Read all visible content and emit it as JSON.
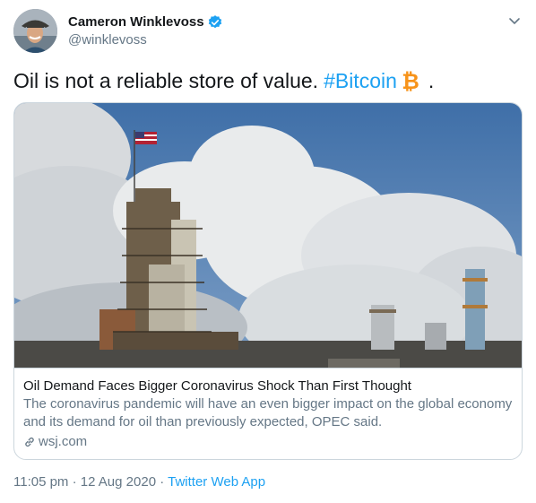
{
  "author": {
    "name": "Cameron Winklevoss",
    "handle": "@winklevoss",
    "verified": true
  },
  "icons": {
    "verified": "verified-badge-icon",
    "menu": "chevron-down-icon",
    "emoji": "bitcoin-icon",
    "link": "link-icon"
  },
  "tweet": {
    "text": "Oil is not a reliable store of value.",
    "hashtag": "#Bitcoin",
    "trailing": "."
  },
  "card": {
    "title": "Oil Demand Faces Bigger Coronavirus Shock Than First Thought",
    "description": "The coronavirus pandemic will have an even bigger impact on the global economy and its demand for oil than previously expected, OPEC said.",
    "domain": "wsj.com"
  },
  "meta": {
    "time": "11:05 pm",
    "separator": "·",
    "date": "12 Aug 2020",
    "source": "Twitter Web App"
  },
  "colors": {
    "accent": "#1da1f2",
    "bitcoin": "#f7931a",
    "text": "#14171a",
    "secondary": "#657786",
    "border": "#ccd6dd"
  }
}
